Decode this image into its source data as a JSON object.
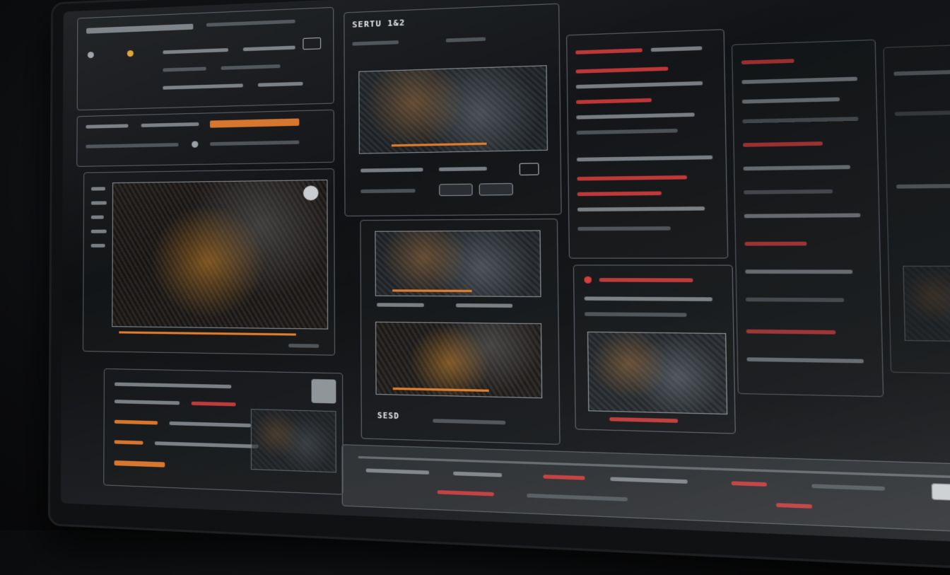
{
  "panels": {
    "center_top_title": "SERTU 1&2",
    "center_bottom_footer": "SESD"
  },
  "colors": {
    "accent": "#e07b28",
    "alert": "#d23a3a",
    "panel_border": "#5b6066"
  }
}
